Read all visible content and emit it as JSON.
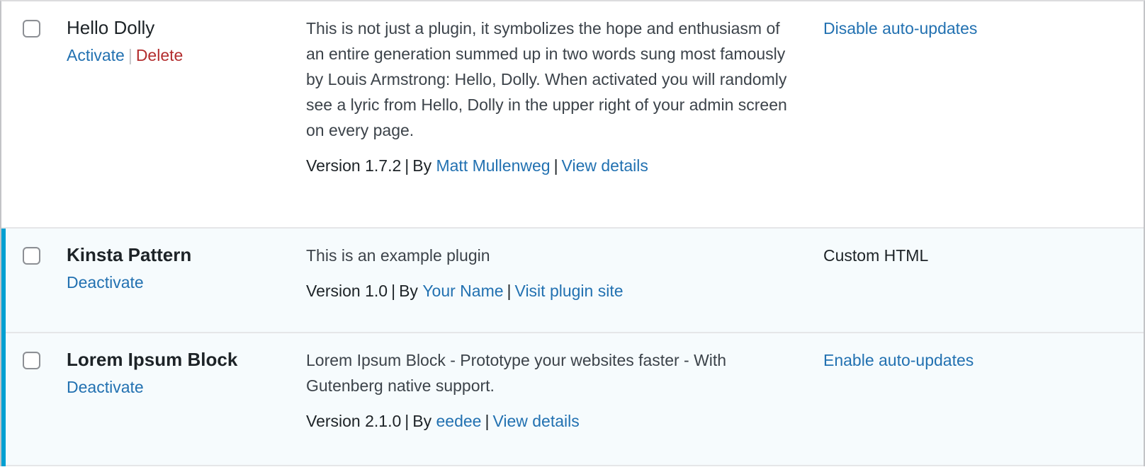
{
  "colors": {
    "link": "#2271b1",
    "delete": "#b32d2e",
    "active_bar": "#00a0d2",
    "active_row_bg": "#f6fbfd",
    "text": "#1d2327",
    "desc_text": "#3c434a",
    "border": "#c3c4c7"
  },
  "table": {
    "rows": [
      {
        "name": "Hello Dolly",
        "bold": false,
        "active": false,
        "checkbox_checked": false,
        "actions": [
          {
            "label": "Activate",
            "kind": "activate"
          },
          {
            "label": "Delete",
            "kind": "delete"
          }
        ],
        "description": "This is not just a plugin, it symbolizes the hope and enthusiasm of an entire generation summed up in two words sung most famously by Louis Armstrong: Hello, Dolly. When activated you will randomly see a lyric from Hello, Dolly in the upper right of your admin screen on every page.",
        "version_prefix": "Version 1.7.2",
        "by_label": "By",
        "author": "Matt Mullenweg",
        "details_link": "View details",
        "auto_update": "Disable auto-updates",
        "auto_update_is_link": true
      },
      {
        "name": "Kinsta Pattern",
        "bold": true,
        "active": true,
        "checkbox_checked": false,
        "actions": [
          {
            "label": "Deactivate",
            "kind": "deactivate"
          }
        ],
        "description": "This is an example plugin",
        "version_prefix": "Version 1.0",
        "by_label": "By",
        "author": "Your Name",
        "details_link": "Visit plugin site",
        "auto_update": "Custom HTML",
        "auto_update_is_link": false
      },
      {
        "name": "Lorem Ipsum Block",
        "bold": true,
        "active": true,
        "checkbox_checked": false,
        "actions": [
          {
            "label": "Deactivate",
            "kind": "deactivate"
          }
        ],
        "description": "Lorem Ipsum Block - Prototype your websites faster - With Gutenberg native support.",
        "version_prefix": "Version 2.1.0",
        "by_label": "By",
        "author": "eedee",
        "details_link": "View details",
        "auto_update": "Enable auto-updates",
        "auto_update_is_link": true
      }
    ]
  }
}
